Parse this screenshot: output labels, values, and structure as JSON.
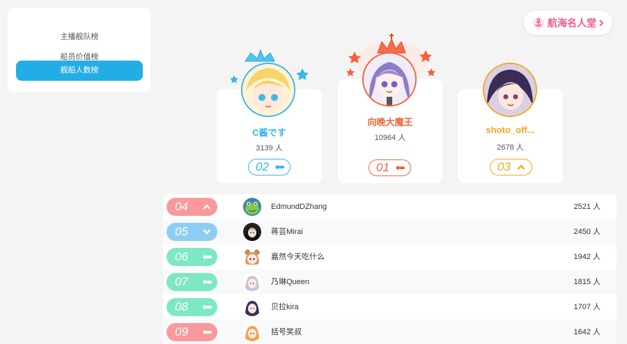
{
  "sidebar": {
    "items": [
      {
        "label": "主播舰队榜"
      },
      {
        "label": "船员价值榜"
      },
      {
        "label": "舰船人数榜"
      }
    ]
  },
  "hall_of_fame": {
    "label": "航海名人堂"
  },
  "podium": [
    {
      "rank": "02",
      "name": "C酱です",
      "count": "3139 人",
      "trend": "same",
      "color": "#37b6ea"
    },
    {
      "rank": "01",
      "name": "向晚大魔王",
      "count": "10964 人",
      "trend": "same",
      "color": "#f0643c"
    },
    {
      "rank": "03",
      "name": "shoto_off...",
      "count": "2678 人",
      "trend": "up",
      "color": "#f5a623"
    }
  ],
  "list": [
    {
      "rank": "04",
      "name": "EdmundDZhang",
      "count": "2521 人",
      "trend": "up",
      "color": "#f9999b"
    },
    {
      "rank": "05",
      "name": "蒋芸Mirai",
      "count": "2450 人",
      "trend": "down",
      "color": "#8ecdf3"
    },
    {
      "rank": "06",
      "name": "嘉然今天吃什么",
      "count": "1942 人",
      "trend": "same",
      "color": "#7ee8c4"
    },
    {
      "rank": "07",
      "name": "乃琳Queen",
      "count": "1815 人",
      "trend": "same",
      "color": "#7ee8c4"
    },
    {
      "rank": "08",
      "name": "贝拉kira",
      "count": "1707 人",
      "trend": "same",
      "color": "#7ee8c4"
    },
    {
      "rank": "09",
      "name": "括号笑叔",
      "count": "1642 人",
      "trend": "same",
      "color": "#f9999b"
    }
  ]
}
